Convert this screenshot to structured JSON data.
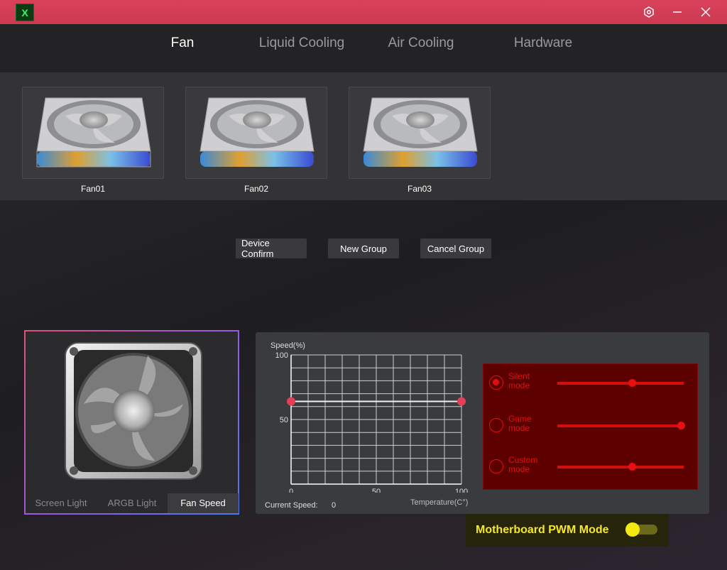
{
  "titlebar": {
    "logo": "X",
    "icons": [
      "settings-icon",
      "minimize-icon",
      "close-icon"
    ],
    "accent": "#d9415a"
  },
  "tabs": [
    {
      "label": "Fan",
      "active": true
    },
    {
      "label": "Liquid Cooling",
      "active": false
    },
    {
      "label": "Air Cooling",
      "active": false
    },
    {
      "label": "Hardware",
      "active": false
    }
  ],
  "fans": [
    {
      "label": "Fan01"
    },
    {
      "label": "Fan02"
    },
    {
      "label": "Fan03"
    }
  ],
  "actions": {
    "device_confirm": "Device Confirm",
    "new_group": "New Group",
    "cancel_group": "Cancel Group"
  },
  "preview": {
    "tabs": [
      {
        "label": "Screen Light",
        "active": false
      },
      {
        "label": "ARGB Light",
        "active": false
      },
      {
        "label": "Fan Speed",
        "active": true
      }
    ]
  },
  "chart_data": {
    "type": "line",
    "ylabel": "Speed(%)",
    "xlabel": "Temperature(C°)",
    "x_ticks": [
      "0",
      "50",
      "100"
    ],
    "y_ticks": [
      "100",
      "50"
    ],
    "xlim": [
      0,
      100
    ],
    "ylim": [
      0,
      100
    ],
    "grid": true,
    "series": [
      {
        "x": [
          0,
          100
        ],
        "y": [
          64,
          64
        ]
      }
    ]
  },
  "current_speed": {
    "label": "Current Speed:",
    "value": "0"
  },
  "modes": [
    {
      "label": "Silent mode",
      "selected": true,
      "level": 0.6
    },
    {
      "label": "Game mode",
      "selected": false,
      "level": 1.0
    },
    {
      "label": "Custom mode",
      "selected": false,
      "level": 0.6
    }
  ],
  "pwm": {
    "label": "Motherboard PWM Mode",
    "enabled": true
  },
  "colors": {
    "mode_red": "#e01010",
    "pwm_yellow": "#f4ea10",
    "point_red": "#e0405a"
  }
}
